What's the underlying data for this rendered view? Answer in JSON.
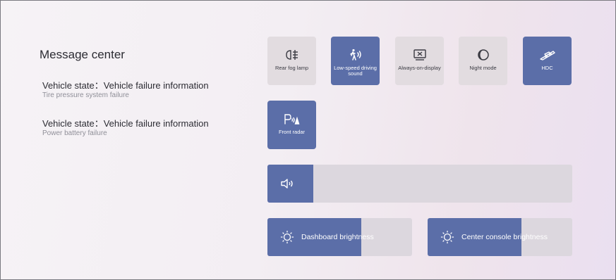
{
  "message_center": {
    "title": "Message center",
    "messages": [
      {
        "title": "Vehicle state：Vehicle failure information",
        "detail": "Tire pressure system failure"
      },
      {
        "title": "Vehicle state：Vehicle failure information",
        "detail": "Power battery failure"
      }
    ]
  },
  "controls": {
    "tiles": [
      {
        "label": "Rear fog lamp",
        "icon": "rear-fog-lamp-icon",
        "active": false
      },
      {
        "label": "Low-speed driving sound",
        "icon": "pedestrian-sound-icon",
        "active": true
      },
      {
        "label": "Always-on-display",
        "icon": "display-off-icon",
        "active": false
      },
      {
        "label": "Night mode",
        "icon": "moon-icon",
        "active": false
      },
      {
        "label": "HDC",
        "icon": "hill-descent-icon",
        "active": true
      },
      {
        "label": "Front radar",
        "icon": "front-radar-icon",
        "active": true
      }
    ],
    "volume": {
      "icon": "speaker-icon",
      "level": 0.15
    },
    "dashboard_brightness": {
      "label": "Dashboard brightness",
      "icon": "sun-icon",
      "level": 0.65
    },
    "console_brightness": {
      "label": "Center console brightness",
      "icon": "sun-icon",
      "level": 0.65
    }
  },
  "colors": {
    "accent": "#5b6ea8",
    "tile_off": "#e2dce0",
    "track": "#dcd7de"
  }
}
